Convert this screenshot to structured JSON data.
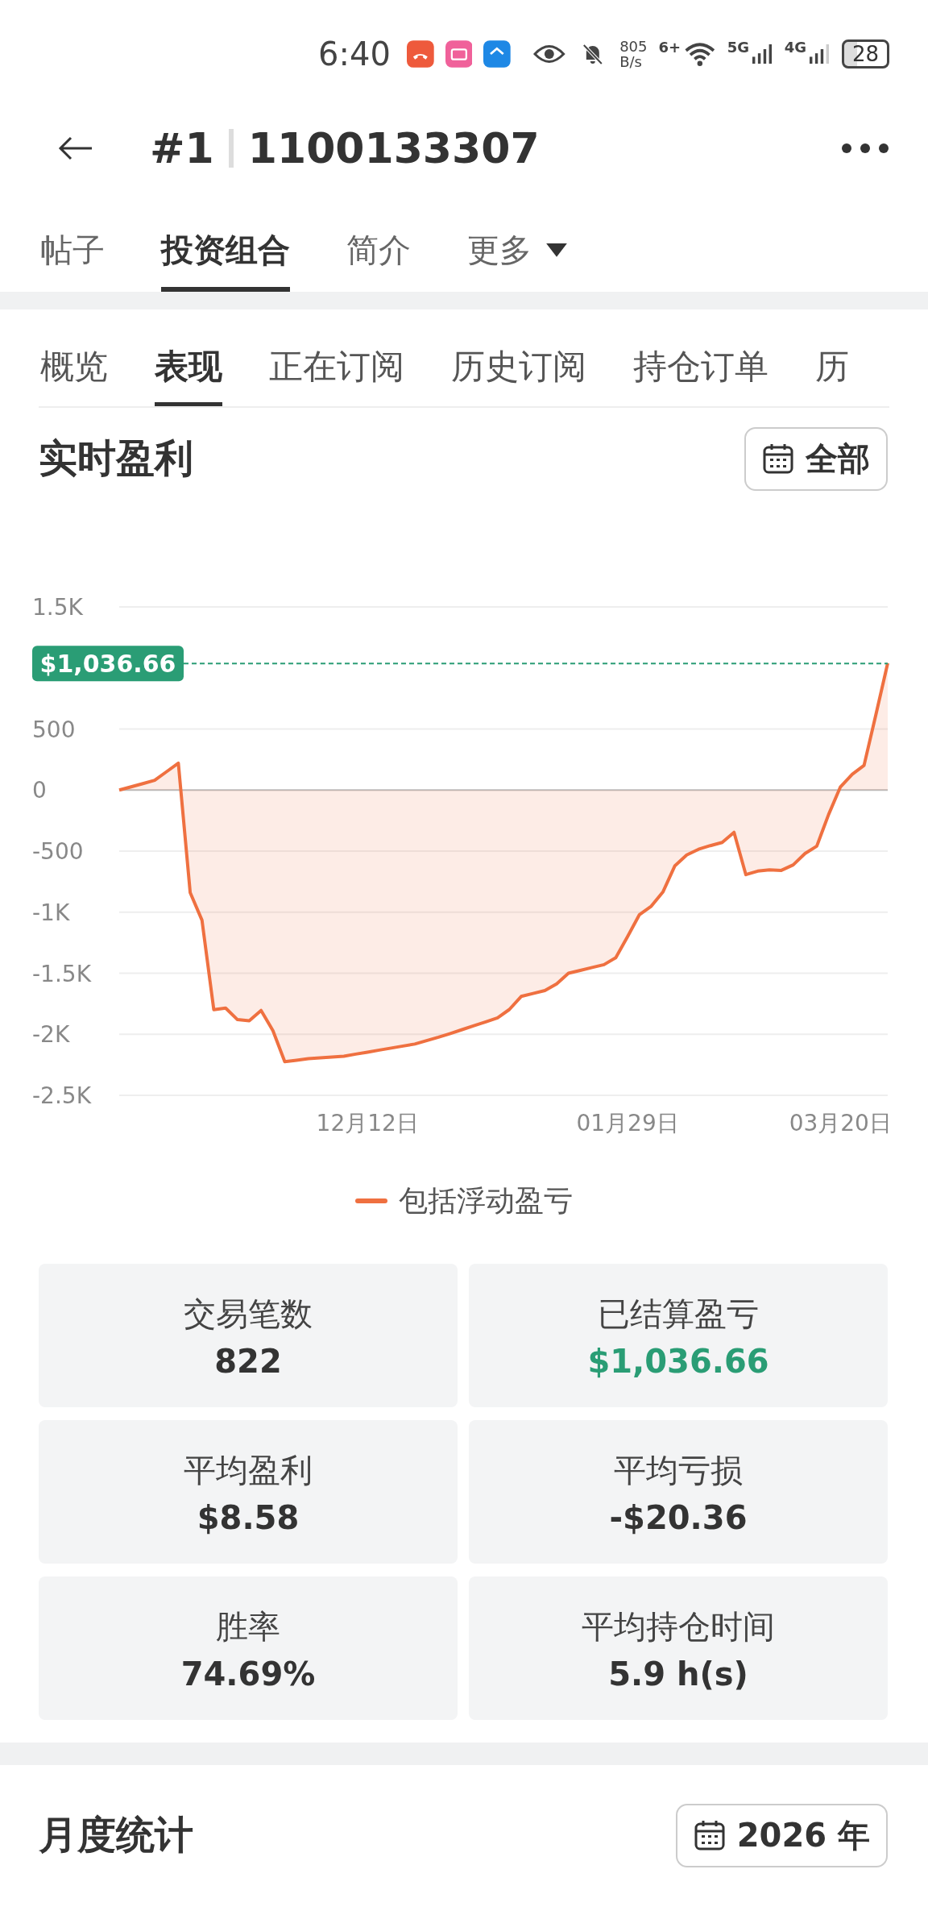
{
  "status_bar": {
    "time": "6:40",
    "net_speed": "805",
    "net_unit": "B/s",
    "wifi_label": "6+",
    "sim1": "5G",
    "sim2": "4G",
    "battery": "28"
  },
  "header": {
    "rank": "#1",
    "account": "1100133307"
  },
  "tabs": [
    {
      "label": "帖子",
      "selected": false,
      "dropdown": false
    },
    {
      "label": "投资组合",
      "selected": true,
      "dropdown": false
    },
    {
      "label": "简介",
      "selected": false,
      "dropdown": false
    },
    {
      "label": "更多",
      "selected": false,
      "dropdown": true
    }
  ],
  "sub_tabs": [
    {
      "label": "概览",
      "selected": false
    },
    {
      "label": "表现",
      "selected": true
    },
    {
      "label": "正在订阅",
      "selected": false
    },
    {
      "label": "历史订阅",
      "selected": false
    },
    {
      "label": "持仓订单",
      "selected": false
    },
    {
      "label": "历",
      "selected": false
    }
  ],
  "pnl_section": {
    "title": "实时盈利",
    "range_button": "全部",
    "chart_data": {
      "type": "area",
      "grid": true,
      "ref_lines": [
        {
          "axis": "y",
          "value": 1036.66,
          "label": "$1,036.66",
          "color": "#2a9d75"
        }
      ],
      "categories": [
        null,
        null,
        null,
        null,
        null,
        null,
        null,
        null,
        null,
        null,
        null,
        null,
        null,
        null,
        null,
        null,
        null,
        null,
        null,
        null,
        null,
        "12月12日",
        null,
        null,
        null,
        null,
        null,
        null,
        null,
        null,
        null,
        null,
        null,
        null,
        null,
        null,
        null,
        null,
        null,
        null,
        null,
        null,
        null,
        "01月29日",
        null,
        null,
        null,
        null,
        null,
        null,
        null,
        null,
        null,
        null,
        null,
        null,
        null,
        null,
        null,
        null,
        null,
        "03月20日",
        null,
        null,
        null,
        null
      ],
      "series": [
        {
          "name": "包括浮动盈亏",
          "color": "#ef7040",
          "values": [
            0,
            27,
            53,
            80,
            150,
            220,
            -840,
            -1065,
            -1799,
            -1786,
            -1880,
            -1890,
            -1805,
            -1970,
            -2224,
            -2212,
            -2200,
            -2193,
            -2187,
            -2180,
            -2163,
            -2147,
            -2130,
            -2113,
            -2097,
            -2080,
            -2052,
            -2024,
            -1994,
            -1962,
            -1930,
            -1898,
            -1866,
            -1797,
            -1690,
            -1666,
            -1642,
            -1587,
            -1500,
            -1477,
            -1453,
            -1430,
            -1373,
            -1200,
            -1020,
            -951,
            -833,
            -620,
            -532,
            -485,
            -455,
            -429,
            -346,
            -693,
            -664,
            -653,
            -658,
            -613,
            -520,
            -460,
            -200,
            26,
            130,
            202,
            617,
            1040
          ]
        }
      ],
      "ylim": [
        -2500,
        1500
      ],
      "yticks": [
        {
          "value": 1500,
          "label": "1.5K"
        },
        {
          "value": 500,
          "label": "500"
        },
        {
          "value": 0,
          "label": "0"
        },
        {
          "value": -500,
          "label": "-500"
        },
        {
          "value": -1000,
          "label": "-1K"
        },
        {
          "value": -1500,
          "label": "-1.5K"
        },
        {
          "value": -2000,
          "label": "-2K"
        },
        {
          "value": -2500,
          "label": "-2.5K"
        }
      ]
    }
  },
  "stats": [
    {
      "label": "交易笔数",
      "value": "822",
      "highlight": false
    },
    {
      "label": "已结算盈亏",
      "value": "$1,036.66",
      "highlight": true
    },
    {
      "label": "平均盈利",
      "value": "$8.58",
      "highlight": false
    },
    {
      "label": "平均亏损",
      "value": "-$20.36",
      "highlight": false
    },
    {
      "label": "胜率",
      "value": "74.69%",
      "highlight": false
    },
    {
      "label": "平均持仓时间",
      "value": "5.9 h(s)",
      "highlight": false
    }
  ],
  "monthly_section": {
    "title": "月度统计",
    "year_button": "2026 年"
  }
}
